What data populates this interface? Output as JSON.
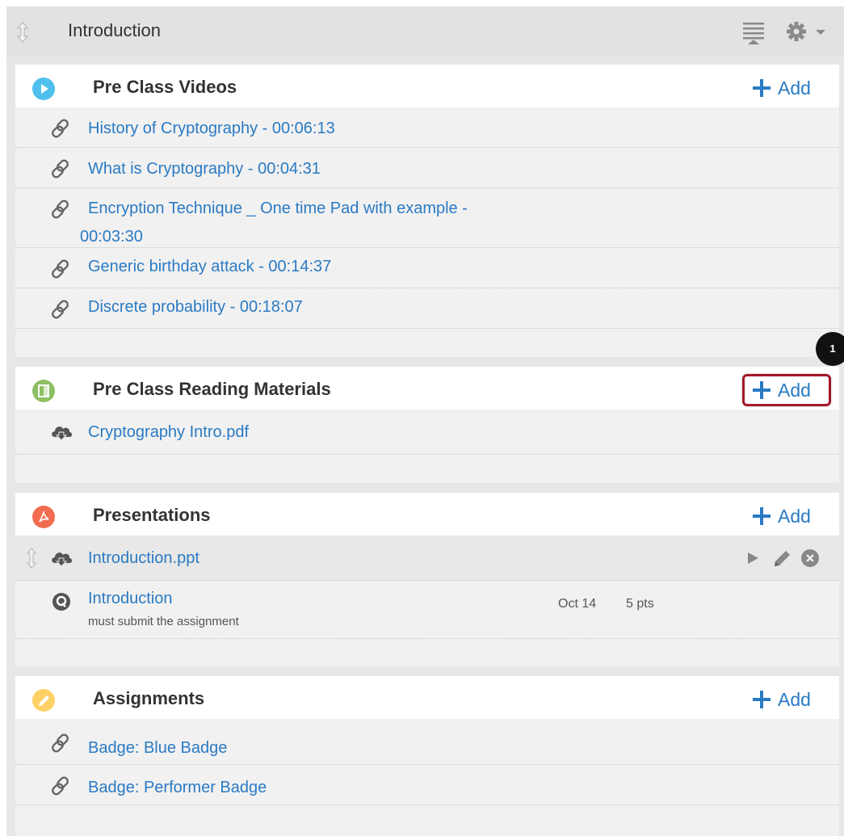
{
  "module": {
    "title": "Introduction"
  },
  "sections": {
    "videos": {
      "title": "Pre Class Videos",
      "add_label": "Add",
      "items": [
        "History of Cryptography - 00:06:13",
        "What is Cryptography - 00:04:31",
        "Encryption Technique _ One time Pad with example - 00:03:30",
        "Generic birthday attack - 00:14:37",
        "Discrete probability - 00:18:07"
      ]
    },
    "reading": {
      "title": "Pre Class Reading Materials",
      "add_label": "Add",
      "items": [
        "Cryptography Intro.pdf"
      ]
    },
    "presentations": {
      "title": "Presentations",
      "add_label": "Add",
      "items": [
        {
          "label": "Introduction.ppt"
        },
        {
          "label": "Introduction",
          "subtitle": "must submit the assignment",
          "due": "Oct 14",
          "points": "5 pts"
        }
      ]
    },
    "assignments": {
      "title": "Assignments",
      "add_label": "Add",
      "items": [
        "Badge: Blue Badge",
        "Badge: Performer Badge"
      ]
    }
  },
  "callout": {
    "number": "1"
  },
  "colors": {
    "link": "#2a7ac3",
    "video_icon": "#4fc0ee",
    "reading_icon": "#8dc063",
    "presentation_icon": "#f26c4f",
    "assignment_icon": "#fdd165",
    "highlight": "#a3182a"
  },
  "icons": {
    "module_drag": "drag-handle-icon",
    "outline": "collapse-outline-icon",
    "gear": "gear-icon",
    "video_link": "link-icon",
    "download": "cloud-download-icon",
    "quiz": "quiz-icon",
    "play": "play-icon",
    "edit": "pencil-icon",
    "remove": "remove-icon"
  }
}
